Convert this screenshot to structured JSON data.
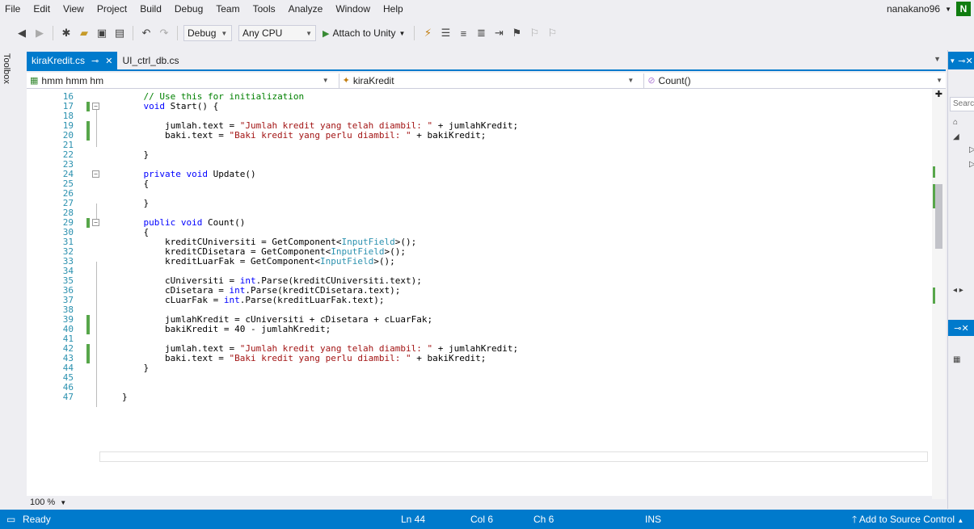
{
  "menu": [
    "File",
    "Edit",
    "View",
    "Project",
    "Build",
    "Debug",
    "Team",
    "Tools",
    "Analyze",
    "Window",
    "Help"
  ],
  "user": {
    "name": "nanakano96",
    "initial": "N"
  },
  "toolbar": {
    "config": "Debug",
    "platform": "Any CPU",
    "attach": "Attach to Unity"
  },
  "toolbox_label": "Toolbox",
  "tabs": [
    {
      "label": "kiraKredit.cs",
      "active": true
    },
    {
      "label": "UI_ctrl_db.cs",
      "active": false
    }
  ],
  "navbar": {
    "project": "hmm hmm hm",
    "class": "kiraKredit",
    "member": "Count()"
  },
  "code_lines": [
    {
      "n": "16",
      "text": "    // Use this for initialization"
    },
    {
      "n": "17",
      "text": "    void Start() {"
    },
    {
      "n": "18",
      "text": ""
    },
    {
      "n": "19",
      "text": "        jumlah.text = \"Jumlah kredit yang telah diambil: \" + jumlahKredit;"
    },
    {
      "n": "20",
      "text": "        baki.text = \"Baki kredit yang perlu diambil: \" + bakiKredit;"
    },
    {
      "n": "21",
      "text": ""
    },
    {
      "n": "22",
      "text": "    }"
    },
    {
      "n": "23",
      "text": ""
    },
    {
      "n": "24",
      "text": "    private void Update()"
    },
    {
      "n": "25",
      "text": "    {"
    },
    {
      "n": "26",
      "text": ""
    },
    {
      "n": "27",
      "text": "    }"
    },
    {
      "n": "28",
      "text": ""
    },
    {
      "n": "29",
      "text": "    public void Count()"
    },
    {
      "n": "30",
      "text": "    {"
    },
    {
      "n": "31",
      "text": "        kreditCUniversiti = GetComponent<InputField>();"
    },
    {
      "n": "32",
      "text": "        kreditCDisetara = GetComponent<InputField>();"
    },
    {
      "n": "33",
      "text": "        kreditLuarFak = GetComponent<InputField>();"
    },
    {
      "n": "34",
      "text": ""
    },
    {
      "n": "35",
      "text": "        cUniversiti = int.Parse(kreditCUniversiti.text);"
    },
    {
      "n": "36",
      "text": "        cDisetara = int.Parse(kreditCDisetara.text);"
    },
    {
      "n": "37",
      "text": "        cLuarFak = int.Parse(kreditLuarFak.text);"
    },
    {
      "n": "38",
      "text": ""
    },
    {
      "n": "39",
      "text": "        jumlahKredit = cUniversiti + cDisetara + cLuarFak;"
    },
    {
      "n": "40",
      "text": "        bakiKredit = 40 - jumlahKredit;"
    },
    {
      "n": "41",
      "text": ""
    },
    {
      "n": "42",
      "text": "        jumlah.text = \"Jumlah kredit yang telah diambil: \" + jumlahKredit;"
    },
    {
      "n": "43",
      "text": "        baki.text = \"Baki kredit yang perlu diambil: \" + bakiKredit;"
    },
    {
      "n": "44",
      "text": "    }"
    },
    {
      "n": "45",
      "text": ""
    },
    {
      "n": "46",
      "text": ""
    },
    {
      "n": "47",
      "text": "}"
    }
  ],
  "changed_lines": [
    "17",
    "19",
    "20",
    "29",
    "39",
    "40",
    "42",
    "43"
  ],
  "fold_lines": [
    "17",
    "24",
    "29"
  ],
  "zoom": "100 %",
  "right_panel": {
    "search_placeholder": "Searc"
  },
  "status": {
    "state": "Ready",
    "ln": "Ln 44",
    "col": "Col 6",
    "ch": "Ch 6",
    "mode": "INS",
    "source_control": "Add to Source Control"
  },
  "colors": {
    "accent": "#007acc",
    "keyword": "#0000ff",
    "string": "#a31515",
    "comment": "#008000",
    "type": "#2b91af",
    "changed": "#57a64a"
  }
}
